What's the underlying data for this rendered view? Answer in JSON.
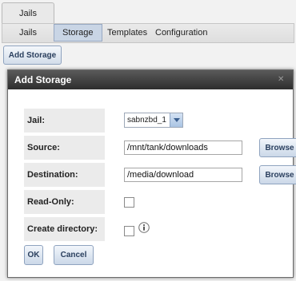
{
  "app": {
    "main_tab": "Jails",
    "subtabs": [
      "Jails",
      "Storage",
      "Templates",
      "Configuration"
    ],
    "add_storage_label": "Add Storage"
  },
  "dialog": {
    "title": "Add Storage",
    "close_icon": "close-icon",
    "fields": {
      "jail": {
        "label": "Jail:",
        "value": "sabnzbd_1"
      },
      "source": {
        "label": "Source:",
        "value": "/mnt/tank/downloads",
        "browse": "Browse"
      },
      "destination": {
        "label": "Destination:",
        "value": "/media/download",
        "browse": "Browse"
      },
      "read_only": {
        "label": "Read-Only:",
        "checked": false
      },
      "create_directory": {
        "label": "Create directory:",
        "checked": false,
        "info_icon": "info-icon"
      }
    },
    "ok_label": "OK",
    "cancel_label": "Cancel"
  },
  "colors": {
    "title_bar": "#3f3f3f",
    "button_text": "#2a3f5e",
    "active_tab": "#c9d5e5"
  }
}
